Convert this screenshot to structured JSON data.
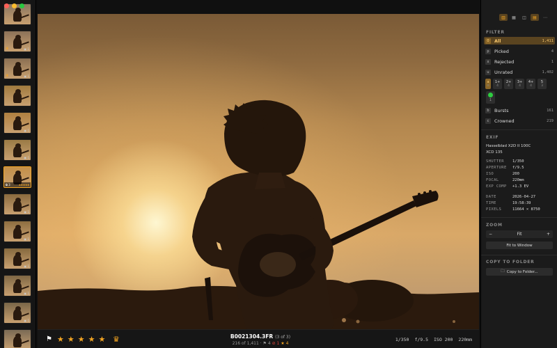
{
  "app": {
    "colors": {
      "accent": "#f5a623",
      "reject": "#e0453b",
      "green": "#2ecc40"
    }
  },
  "filmstrip": {
    "thumbnails": [
      {
        "meta": "",
        "crown": false
      },
      {
        "meta": "1",
        "crown": true
      },
      {
        "meta": "1",
        "crown": true
      },
      {
        "meta": "",
        "crown": false
      },
      {
        "meta": "1",
        "crown": false
      },
      {
        "meta": "1",
        "crown": false
      },
      {
        "meta": "3",
        "crown": false,
        "selected": true
      },
      {
        "meta": "1",
        "crown": false
      },
      {
        "meta": "1",
        "crown": false
      },
      {
        "meta": "1",
        "crown": false
      },
      {
        "meta": "1",
        "crown": false
      },
      {
        "meta": "1",
        "crown": false
      },
      {
        "meta": "",
        "crown": false
      }
    ],
    "selected_badge": "3",
    "selected_stars": "★★★★★"
  },
  "bottom_bar": {
    "flag_icon": "flag-icon",
    "star_rating": 5,
    "filename": "B0021304.3FR",
    "burst_count": "(3 of 3)",
    "position": "216 of 1,411",
    "picked_count": "4",
    "rejected_count": "1",
    "stars_count": "4",
    "exif_shutter": "1/350",
    "exif_aperture": "f/9.5",
    "exif_iso": "ISO 200",
    "exif_focal": "220mm"
  },
  "panel": {
    "filter_title": "FILTER",
    "filters": [
      {
        "key": "0",
        "label": "All",
        "count": "1,411",
        "active": true
      },
      {
        "key": "p",
        "label": "Picked",
        "count": "4"
      },
      {
        "key": "x",
        "label": "Rejected",
        "count": "1"
      },
      {
        "key": "u",
        "label": "Unrated",
        "count": "1,402"
      }
    ],
    "rating_filters": [
      {
        "label": "1+",
        "count": "4"
      },
      {
        "label": "2+",
        "count": "4"
      },
      {
        "label": "3+",
        "count": "4"
      },
      {
        "label": "4+",
        "count": "4"
      },
      {
        "label": "5",
        "count": "3"
      }
    ],
    "rating_key": "a",
    "green_count": "1",
    "extra_filters": [
      {
        "key": "b",
        "label": "Bursts",
        "count": "161"
      },
      {
        "key": "c",
        "label": "Crowned",
        "count": "219"
      }
    ],
    "exif_title": "EXIF",
    "camera": "Hasselblad X2D II 100C",
    "lens": "XCD 135",
    "exif": [
      {
        "k": "SHUTTER",
        "v": "1/350"
      },
      {
        "k": "APERTURE",
        "v": "f/9.5"
      },
      {
        "k": "ISO",
        "v": "200"
      },
      {
        "k": "FOCAL",
        "v": "220mm"
      },
      {
        "k": "EXP COMP",
        "v": "+1.3 EV"
      }
    ],
    "exif2": [
      {
        "k": "DATE",
        "v": "2026-04-27"
      },
      {
        "k": "TIME",
        "v": "19:58:39"
      },
      {
        "k": "PIXELS",
        "v": "11664 × 8750"
      }
    ],
    "zoom_title": "ZOOM",
    "zoom_value": "Fit",
    "zoom_minus": "−",
    "zoom_plus": "+",
    "fit_to_window": "Fit to Window",
    "copy_title": "COPY TO FOLDER",
    "copy_button": "Copy to Folder..."
  }
}
